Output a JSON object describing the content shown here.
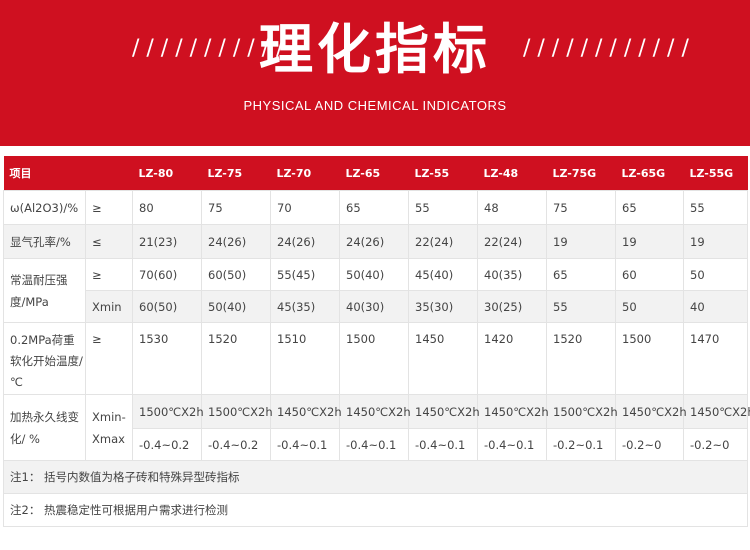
{
  "banner": {
    "title": "理化指标",
    "subtitle": "PHYSICAL AND CHEMICAL INDICATORS",
    "slashes": "/ / / / / / / / / / / /",
    "background_color": "#cf1020"
  },
  "table": {
    "headers": [
      "项目",
      "",
      "LZ-80",
      "LZ-75",
      "LZ-70",
      "LZ-65",
      "LZ-55",
      "LZ-48",
      "LZ-75G",
      "LZ-65G",
      "LZ-55G"
    ],
    "rows": {
      "al2o3": {
        "label": "ω(Al2O3)/%",
        "op": "≥",
        "values": [
          "80",
          "75",
          "70",
          "65",
          "55",
          "48",
          "75",
          "65",
          "55"
        ]
      },
      "porosity": {
        "label": "显气孔率/%",
        "op": "≤",
        "values": [
          "21(23)",
          "24(26)",
          "24(26)",
          "24(26)",
          "22(24)",
          "22(24)",
          "19",
          "19",
          "19"
        ]
      },
      "strength": {
        "label": "常温耐压强度/MPa",
        "op1": "≥",
        "values1": [
          "70(60)",
          "60(50)",
          "55(45)",
          "50(40)",
          "45(40)",
          "40(35)",
          "65",
          "60",
          "50"
        ],
        "op2": "Xmin",
        "values2": [
          "60(50)",
          "50(40)",
          "45(35)",
          "40(30)",
          "35(30)",
          "30(25)",
          "55",
          "50",
          "40"
        ]
      },
      "softening": {
        "label": "0.2MPa荷重软化开始温度/ ℃",
        "op": "≥",
        "values": [
          "1530",
          "1520",
          "1510",
          "1500",
          "1450",
          "1420",
          "1520",
          "1500",
          "1470"
        ]
      },
      "linear": {
        "label": "加热永久线变化/ %",
        "op": "Xmin-Xmax",
        "values1": [
          "1500℃X2h",
          "1500℃X2h",
          "1450℃X2h",
          "1450℃X2h",
          "1450℃X2h",
          "1450℃X2h",
          "1500℃X2h",
          "1450℃X2h",
          "1450℃X2h"
        ],
        "values2": [
          "-0.4~0.2",
          "-0.4~0.2",
          "-0.4~0.1",
          "-0.4~0.1",
          "-0.4~0.1",
          "-0.4~0.1",
          "-0.2~0.1",
          "-0.2~0",
          "-0.2~0"
        ]
      }
    },
    "notes": [
      "注1：  括号内数值为格子砖和特殊异型砖指标",
      "注2：  热震稳定性可根据用户需求进行检测"
    ]
  }
}
